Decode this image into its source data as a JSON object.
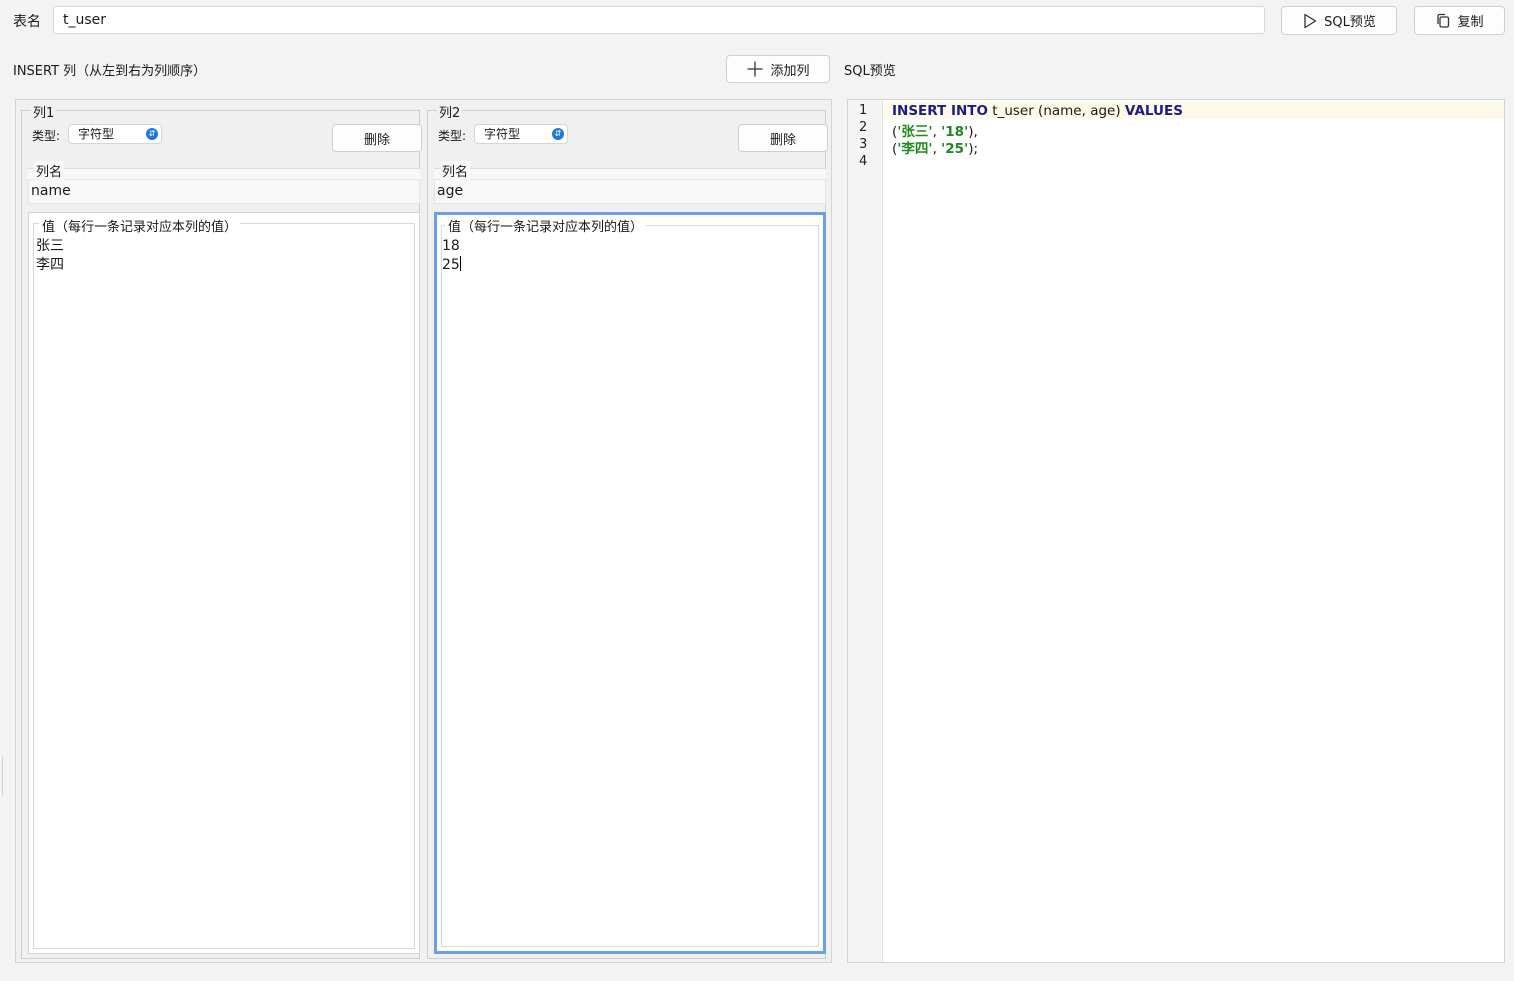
{
  "top_bar": {
    "table_label": "表名",
    "table_name": "t_user",
    "sql_preview_label": "SQL预览",
    "copy_label": "复制"
  },
  "columns_section": {
    "heading": "INSERT 列（从左到右为列顺序）",
    "add_column_label": "添加列"
  },
  "columns": [
    {
      "title": "列1",
      "type_label": "类型:",
      "type_value": "字符型",
      "delete_label": "删除",
      "name_legend": "列名",
      "name_value": "name",
      "values_legend": "值（每行一条记录对应本列的值）",
      "values": [
        "张三",
        "李四"
      ]
    },
    {
      "title": "列2",
      "type_label": "类型:",
      "type_value": "字符型",
      "delete_label": "删除",
      "name_legend": "列名",
      "name_value": "age",
      "values_legend": "值（每行一条记录对应本列的值）",
      "values": [
        "18",
        "25"
      ]
    }
  ],
  "sql": {
    "heading": "SQL预览",
    "line_numbers": [
      "1",
      "2",
      "3",
      "4"
    ],
    "line1": {
      "kw1": "INSERT INTO",
      "mid": " t_user (name, age) ",
      "kw2": "VALUES"
    },
    "line2": {
      "open": "(",
      "s1": "'张三'",
      "sep": ", ",
      "s2": "'18'",
      "close": "),"
    },
    "line3": {
      "open": "(",
      "s1": "'李四'",
      "sep": ", ",
      "s2": "'25'",
      "close": ");"
    }
  },
  "icons": {
    "play": "play-icon",
    "copy": "copy-icon",
    "plus": "plus-icon",
    "select_arrow": "chevron-updown-icon"
  },
  "colors": {
    "keyword": "#1b1b8a",
    "string": "#1e8a1e",
    "focus_border": "#6aa0e8",
    "select_arrow": "#1f7ad4"
  }
}
